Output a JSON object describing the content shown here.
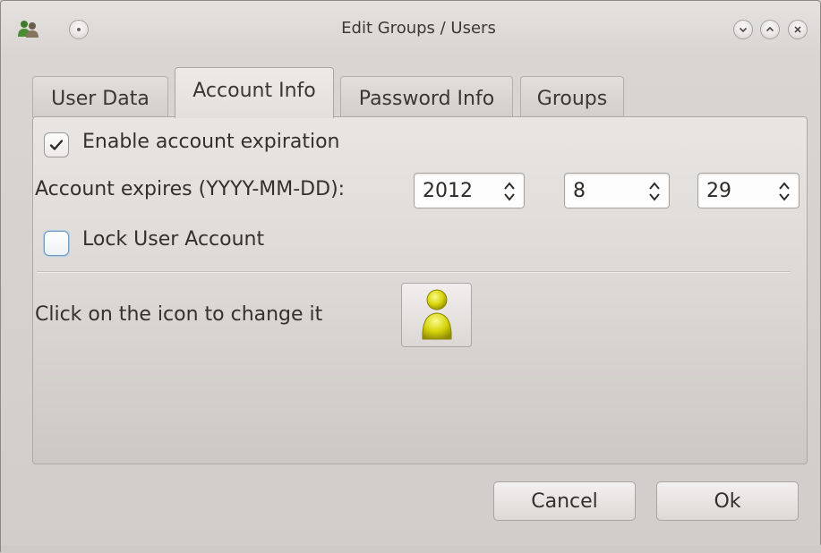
{
  "window": {
    "title": "Edit Groups / Users",
    "icons": {
      "app": "users-icon",
      "menu": "window-menu-icon",
      "minimize": "chevron-down-icon",
      "maximize": "chevron-up-icon",
      "close": "close-icon"
    }
  },
  "tabs": [
    {
      "label": "User Data",
      "active": false
    },
    {
      "label": "Account Info",
      "active": true
    },
    {
      "label": "Password Info",
      "active": false
    },
    {
      "label": "Groups",
      "active": false
    }
  ],
  "account_info": {
    "enable_expiration": {
      "label": "Enable account expiration",
      "checked": true
    },
    "expires": {
      "label": "Account expires (YYYY-MM-DD):",
      "year": "2012",
      "month": "8",
      "day": "29"
    },
    "lock_account": {
      "label": "Lock User Account",
      "checked": false
    },
    "icon_hint": "Click on the icon to change it",
    "user_icon": "user-avatar-icon"
  },
  "buttons": {
    "cancel": "Cancel",
    "ok": "Ok"
  },
  "colors": {
    "background": "#d6d1ce",
    "avatar": "#d6d40a",
    "focus": "#6e9ec9"
  }
}
